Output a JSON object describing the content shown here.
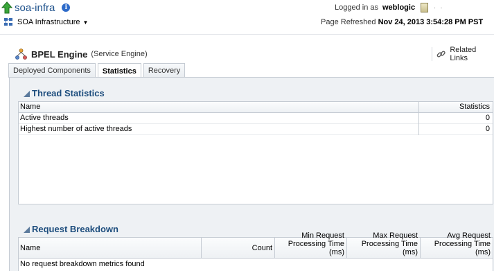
{
  "header": {
    "title": "soa-infra",
    "logged_in_label": "Logged in as",
    "user": "weblogic",
    "server_dots": "· ·",
    "menu_label": "SOA Infrastructure",
    "refresh_label": "Page Refreshed",
    "refresh_time": "Nov 24, 2013 3:54:28 PM PST"
  },
  "engine": {
    "name": "BPEL Engine",
    "type": "(Service Engine)",
    "related_links": "Related Links"
  },
  "tabs": [
    {
      "label": "Deployed Components",
      "active": false
    },
    {
      "label": "Statistics",
      "active": true
    },
    {
      "label": "Recovery",
      "active": false
    }
  ],
  "thread_stats": {
    "title": "Thread Statistics",
    "columns": [
      "Name",
      "Statistics"
    ],
    "rows": [
      {
        "name": "Active threads",
        "value": "0"
      },
      {
        "name": "Highest number of active threads",
        "value": "0"
      }
    ]
  },
  "request_breakdown": {
    "title": "Request Breakdown",
    "columns": {
      "name": "Name",
      "count": "Count",
      "min_1": "Min Request",
      "min_2": "Processing Time (ms)",
      "max_1": "Max Request",
      "max_2": "Processing Time (ms)",
      "avg_1": "Avg Request",
      "avg_2": "Processing Time (ms)"
    },
    "empty_message": "No request breakdown metrics found"
  },
  "icons": {
    "up": "green-up-arrow-icon",
    "info": "info-icon",
    "server": "server-icon",
    "soa": "soa-infrastructure-icon",
    "engine": "bpel-engine-icon",
    "related": "chain-link-icon",
    "collapse": "collapse-triangle-icon"
  },
  "colors": {
    "title_blue": "#1b4f8a",
    "section_title": "#1d4d7d",
    "panel_bg": "#eef1f4",
    "border": "#c5cbd3"
  }
}
